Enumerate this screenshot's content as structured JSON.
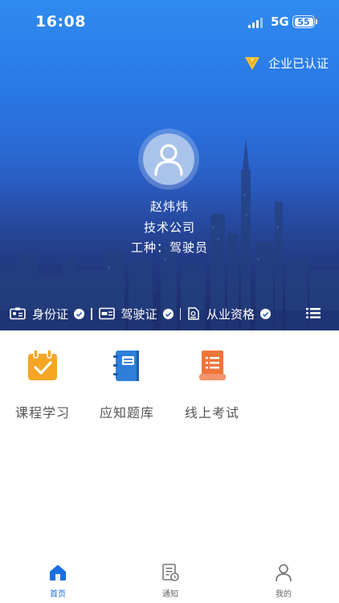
{
  "status_bar": {
    "time": "16:08",
    "network": "5G",
    "battery": "55"
  },
  "header": {
    "certification": "企业已认证"
  },
  "profile": {
    "name": "赵炜炜",
    "company": "技术公司",
    "job_type_label": "工种：",
    "job_type": "驾驶员"
  },
  "credentials": [
    {
      "label": "身份证",
      "icon": "id-card-icon",
      "verified": true
    },
    {
      "label": "驾驶证",
      "icon": "driver-license-icon",
      "verified": true
    },
    {
      "label": "从业资格",
      "icon": "certificate-icon",
      "verified": true
    }
  ],
  "features": [
    {
      "label": "课程学习",
      "icon": "calendar-check-icon",
      "color": "#f5a623"
    },
    {
      "label": "应知题库",
      "icon": "notebook-icon",
      "color": "#2f7fd8"
    },
    {
      "label": "线上考试",
      "icon": "exam-paper-icon",
      "color": "#f0753a"
    }
  ],
  "tabbar": {
    "items": [
      {
        "label": "首页",
        "icon": "home-icon",
        "active": true
      },
      {
        "label": "通知",
        "icon": "notification-document-icon",
        "active": false
      },
      {
        "label": "我的",
        "icon": "user-icon",
        "active": false
      }
    ]
  },
  "colors": {
    "accent": "#1a6fe0",
    "hero_top": "#2f8bf0",
    "hero_bottom": "#1e2b63",
    "course": "#f5a623",
    "bank": "#2f7fd8",
    "exam": "#f0753a"
  }
}
